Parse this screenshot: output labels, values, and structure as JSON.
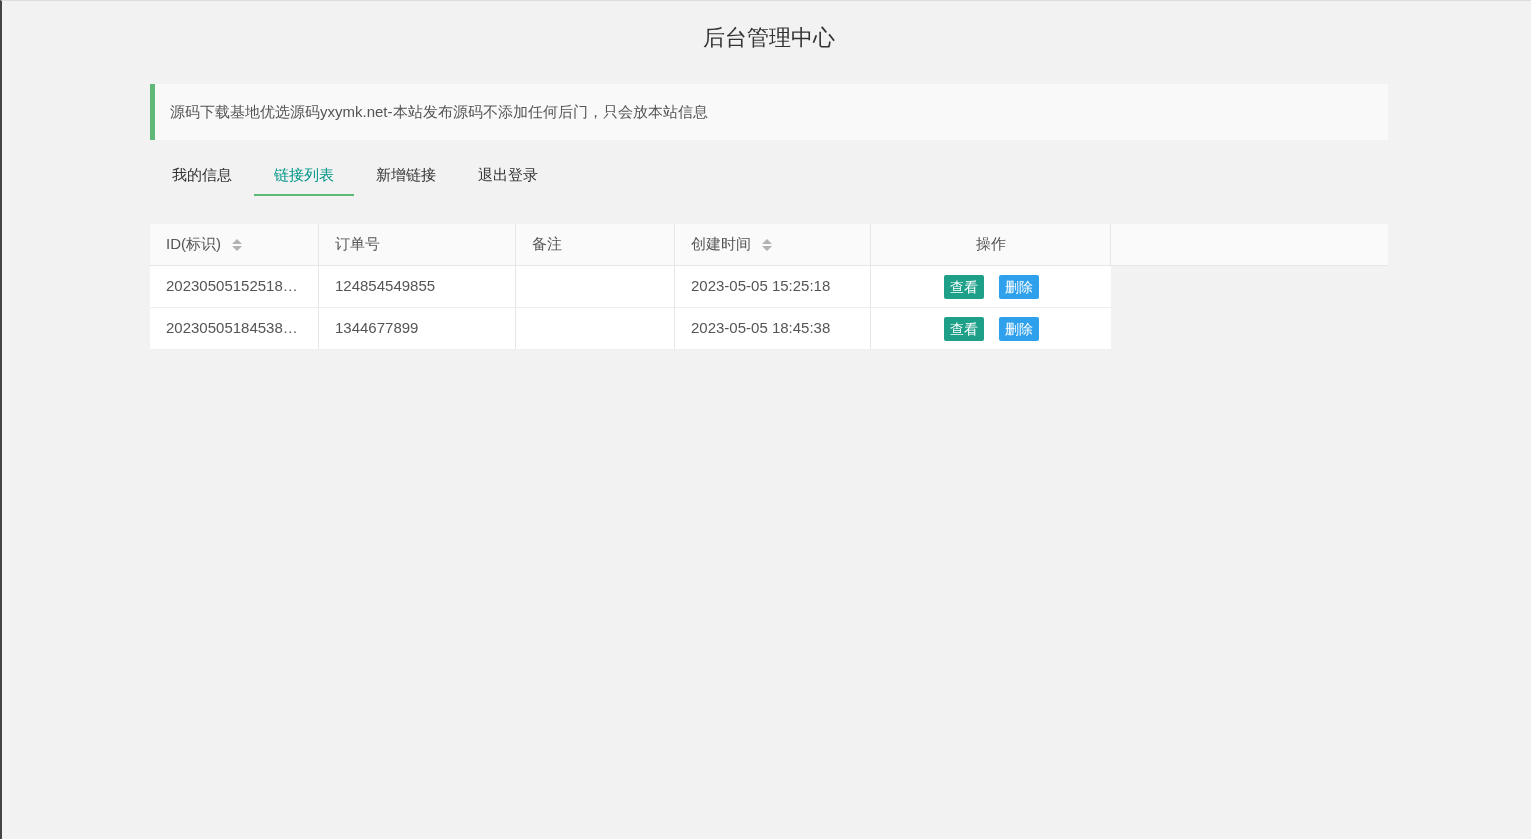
{
  "header": {
    "title": "后台管理中心"
  },
  "notice": {
    "text": "源码下载基地优选源码yxymk.net-本站发布源码不添加任何后门，只会放本站信息"
  },
  "tabs": [
    {
      "label": "我的信息",
      "selected": false
    },
    {
      "label": "链接列表",
      "selected": true
    },
    {
      "label": "新增链接",
      "selected": false
    },
    {
      "label": "退出登录",
      "selected": false
    }
  ],
  "table": {
    "columns": [
      {
        "label": "ID(标识)",
        "sortable": true
      },
      {
        "label": "订单号",
        "sortable": false
      },
      {
        "label": "备注",
        "sortable": false
      },
      {
        "label": "创建时间",
        "sortable": true
      },
      {
        "label": "操作",
        "sortable": false
      }
    ],
    "rows": [
      {
        "cells": [
          "20230505152518…",
          "124854549855",
          "",
          "2023-05-05 15:25:18"
        ],
        "actions": [
          {
            "kind": "view",
            "label": "查看"
          },
          {
            "kind": "delete",
            "label": "删除"
          }
        ]
      },
      {
        "cells": [
          "20230505184538…",
          "1344677899",
          "",
          "2023-05-05 18:45:38"
        ],
        "actions": [
          {
            "kind": "view",
            "label": "查看"
          },
          {
            "kind": "delete",
            "label": "删除"
          }
        ]
      }
    ]
  }
}
